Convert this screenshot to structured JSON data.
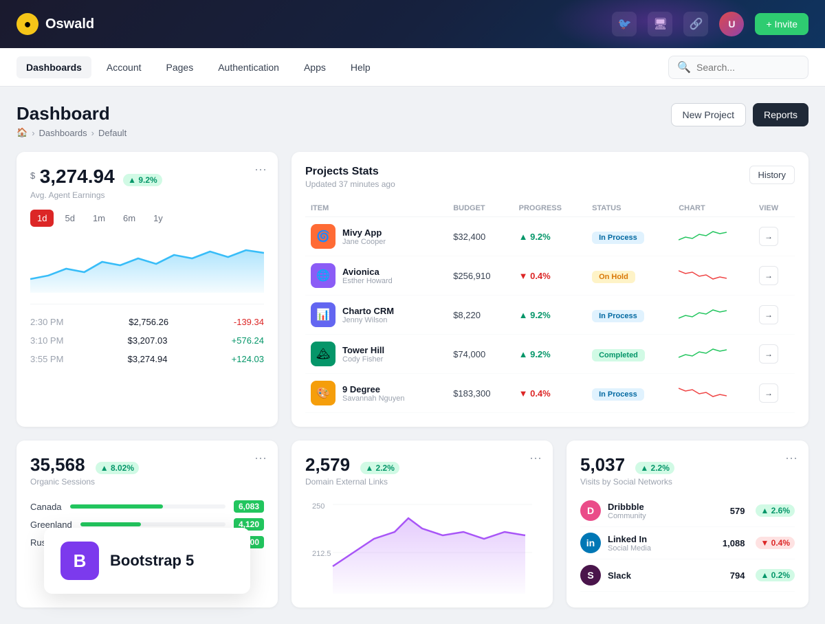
{
  "topbar": {
    "logo_symbol": "●",
    "logo_name": "Oswald",
    "invite_label": "+ Invite"
  },
  "nav": {
    "tabs": [
      {
        "label": "Dashboards",
        "active": true
      },
      {
        "label": "Account",
        "active": false
      },
      {
        "label": "Pages",
        "active": false
      },
      {
        "label": "Authentication",
        "active": false
      },
      {
        "label": "Apps",
        "active": false
      },
      {
        "label": "Help",
        "active": false
      }
    ],
    "search_placeholder": "Search..."
  },
  "page": {
    "title": "Dashboard",
    "breadcrumb": [
      "🏠",
      "Dashboards",
      "Default"
    ],
    "actions": {
      "new_project": "New Project",
      "reports": "Reports"
    }
  },
  "earnings": {
    "currency": "$",
    "value": "3,274.94",
    "badge": "▲ 9.2%",
    "subtitle": "Avg. Agent Earnings",
    "time_filters": [
      "1d",
      "5d",
      "1m",
      "6m",
      "1y"
    ],
    "active_filter": "1d",
    "rows": [
      {
        "time": "2:30 PM",
        "amount": "$2,756.26",
        "change": "-139.34",
        "positive": false
      },
      {
        "time": "3:10 PM",
        "amount": "$3,207.03",
        "change": "+576.24",
        "positive": true
      },
      {
        "time": "3:55 PM",
        "amount": "$3,274.94",
        "change": "+124.03",
        "positive": true
      }
    ]
  },
  "projects": {
    "title": "Projects Stats",
    "subtitle": "Updated 37 minutes ago",
    "history_btn": "History",
    "columns": [
      "ITEM",
      "BUDGET",
      "PROGRESS",
      "STATUS",
      "CHART",
      "VIEW"
    ],
    "rows": [
      {
        "name": "Mivy App",
        "person": "Jane Cooper",
        "budget": "$32,400",
        "progress": "▲ 9.2%",
        "progress_up": true,
        "status": "In Process",
        "status_type": "inprocess",
        "icon_bg": "#ff6b35",
        "icon": "🌀"
      },
      {
        "name": "Avionica",
        "person": "Esther Howard",
        "budget": "$256,910",
        "progress": "▼ 0.4%",
        "progress_up": false,
        "status": "On Hold",
        "status_type": "onhold",
        "icon_bg": "#8b5cf6",
        "icon": "🌐"
      },
      {
        "name": "Charto CRM",
        "person": "Jenny Wilson",
        "budget": "$8,220",
        "progress": "▲ 9.2%",
        "progress_up": true,
        "status": "In Process",
        "status_type": "inprocess",
        "icon_bg": "#6366f1",
        "icon": "📊"
      },
      {
        "name": "Tower Hill",
        "person": "Cody Fisher",
        "budget": "$74,000",
        "progress": "▲ 9.2%",
        "progress_up": true,
        "status": "Completed",
        "status_type": "completed",
        "icon_bg": "#059669",
        "icon": "🏔"
      },
      {
        "name": "9 Degree",
        "person": "Savannah Nguyen",
        "budget": "$183,300",
        "progress": "▼ 0.4%",
        "progress_up": false,
        "status": "In Process",
        "status_type": "inprocess",
        "icon_bg": "#f59e0b",
        "icon": "🎨"
      }
    ]
  },
  "sessions": {
    "value": "35,568",
    "badge": "▲ 8.02%",
    "subtitle": "Organic Sessions",
    "countries": [
      {
        "name": "Canada",
        "value": "6,083",
        "pct": 60
      },
      {
        "name": "Greenland",
        "value": "4,120",
        "pct": 42
      },
      {
        "name": "Russia",
        "value": "3,900",
        "pct": 38
      }
    ]
  },
  "domain_links": {
    "value": "2,579",
    "badge": "▲ 2.2%",
    "subtitle": "Domain External Links"
  },
  "social": {
    "value": "5,037",
    "badge": "▲ 2.2%",
    "subtitle": "Visits by Social Networks",
    "networks": [
      {
        "name": "Dribbble",
        "type": "Community",
        "value": "579",
        "badge": "▲ 2.6%",
        "positive": true,
        "color": "#ea4c89"
      },
      {
        "name": "Linked In",
        "type": "Social Media",
        "value": "1,088",
        "badge": "▼ 0.4%",
        "positive": false,
        "color": "#0077b5"
      },
      {
        "name": "Slack",
        "type": "",
        "value": "794",
        "badge": "▲ 0.2%",
        "positive": true,
        "color": "#4a154b"
      }
    ]
  },
  "bootstrap": {
    "icon": "B",
    "label": "Bootstrap 5"
  }
}
